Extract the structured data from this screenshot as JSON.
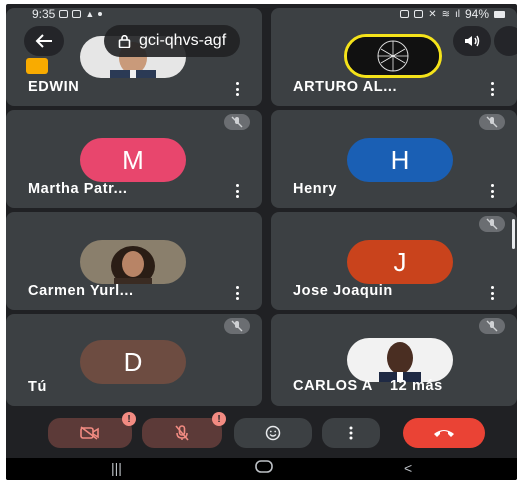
{
  "status_bar": {
    "time": "9:35",
    "battery": "94%"
  },
  "meeting": {
    "code": "gci-qhvs-agf"
  },
  "participants": [
    {
      "name": "EDWIN",
      "avatar_type": "photo",
      "muted": false
    },
    {
      "name": "ARTURO AL...",
      "avatar_type": "photo",
      "muted": false
    },
    {
      "name": "Martha Patr...",
      "initial": "M",
      "avatar_color": "#e8466d",
      "muted": true
    },
    {
      "name": "Henry",
      "initial": "H",
      "avatar_color": "#1a5fb4",
      "muted": true
    },
    {
      "name": "Carmen Yurl...",
      "avatar_type": "photo",
      "muted": false
    },
    {
      "name": "Jose Joaquin",
      "initial": "J",
      "avatar_color": "#c9431c",
      "muted": true
    },
    {
      "name": "Tú",
      "initial": "D",
      "avatar_color": "#6d4c41",
      "muted": true
    },
    {
      "name": "CARLOS A",
      "avatar_type": "photo",
      "muted": true
    }
  ],
  "more_participants": "12 más",
  "controls": {
    "camera_badge": "!",
    "mic_badge": "!"
  },
  "colors": {
    "background": "#202124",
    "tile": "#3c4043",
    "end_call": "#ea4335"
  }
}
